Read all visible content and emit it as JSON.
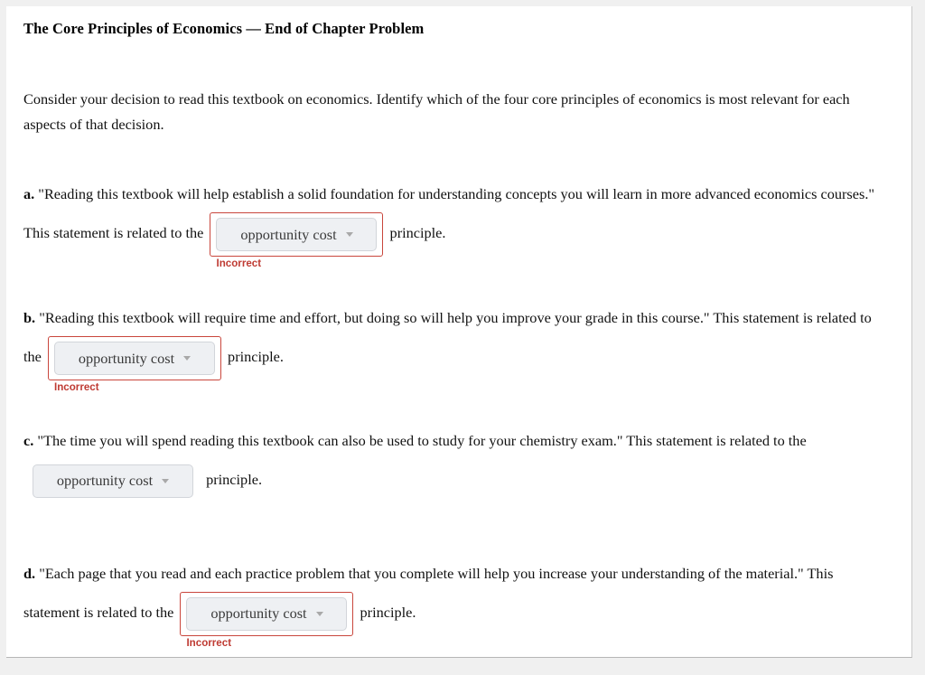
{
  "page": {
    "title": "The Core Principles of Economics — End of Chapter Problem",
    "intro": "Consider your decision to read this textbook on economics. Identify which of the four core principles of economics is most relevant for each aspects of that decision.",
    "background_color": "#f0f0f0",
    "card_color": "#ffffff",
    "error_color": "#c9463c",
    "feedback_text_color": "#bf3b33",
    "dropdown_fill_color": "#eef0f3"
  },
  "questions": [
    {
      "letter": "a.",
      "text_before": "\"Reading this textbook will help establish a solid foundation for understanding concepts you will learn in more advanced economics courses.\" This statement is related to the",
      "text_after": "principle.",
      "dropdown": {
        "value": "opportunity cost",
        "caret_icon": "chevron-down-icon"
      },
      "status": "incorrect",
      "feedback": "Incorrect"
    },
    {
      "letter": "b.",
      "text_before": "\"Reading this textbook will require time and effort, but doing so will help you improve your grade in this course.\" This statement is related to the",
      "text_after": "principle.",
      "dropdown": {
        "value": "opportunity cost",
        "caret_icon": "chevron-down-icon"
      },
      "status": "incorrect",
      "feedback": "Incorrect"
    },
    {
      "letter": "c.",
      "text_before": "\"The time you will spend reading this textbook can also be used to study for your chemistry exam.\" This statement is related to the",
      "text_after": "principle.",
      "dropdown": {
        "value": "opportunity cost",
        "caret_icon": "chevron-down-icon"
      },
      "status": "none",
      "feedback": ""
    },
    {
      "letter": "d.",
      "text_before": "\"Each page that you read and each practice problem that you complete will help you increase your understanding of the material.\" This statement is related to the",
      "text_after": "principle.",
      "dropdown": {
        "value": "opportunity cost",
        "caret_icon": "chevron-down-icon"
      },
      "status": "incorrect",
      "feedback": "Incorrect"
    }
  ]
}
